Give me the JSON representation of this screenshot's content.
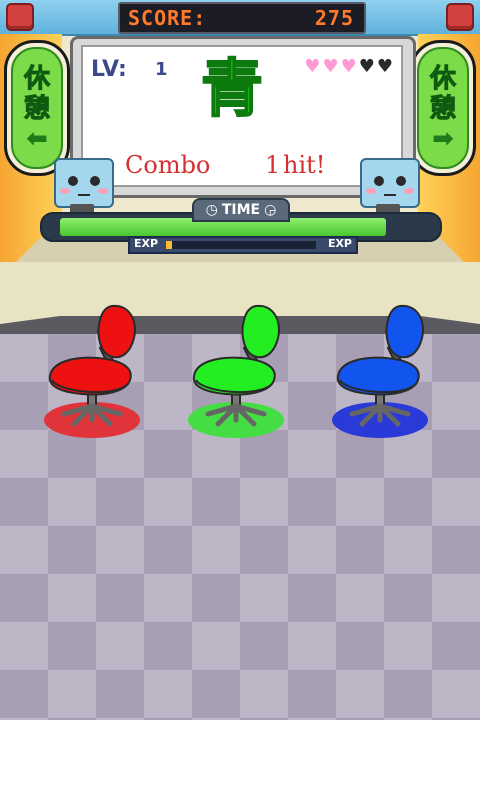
{
  "header": {
    "score_label": "SCORE:",
    "score_value": "275"
  },
  "left_button": {
    "kanji_top": "休",
    "kanji_bottom": "憩",
    "arrow": "⬅"
  },
  "right_button": {
    "kanji_top": "休",
    "kanji_bottom": "憩",
    "arrow": "➡"
  },
  "board": {
    "level_label": "LV:",
    "level_value": "1",
    "word": "青",
    "word_color": "#22dd22",
    "lives_total": 5,
    "lives_remaining": 3,
    "combo_label": "Combo",
    "combo_count": "1",
    "combo_unit": "hit!"
  },
  "timer": {
    "label": "TIME",
    "remaining_fraction": 0.9
  },
  "exp": {
    "left_label": "EXP",
    "right_label": "EXP",
    "fraction": 0.04
  },
  "chairs": [
    {
      "color_name": "red",
      "color": "#ee1111",
      "shadow": "#e0343a"
    },
    {
      "color_name": "green",
      "color": "#22ee22",
      "shadow": "#44dd44"
    },
    {
      "color_name": "blue",
      "color": "#1155ee",
      "shadow": "#2a3ad8"
    }
  ],
  "colors": {
    "score_text": "#ff7a2a",
    "combo_text": "#d43030",
    "heart_full": "#ff9ad5",
    "heart_empty": "#2a2a2a",
    "floor_light": "#bdb6c7",
    "floor_dark": "#a89fb5"
  }
}
